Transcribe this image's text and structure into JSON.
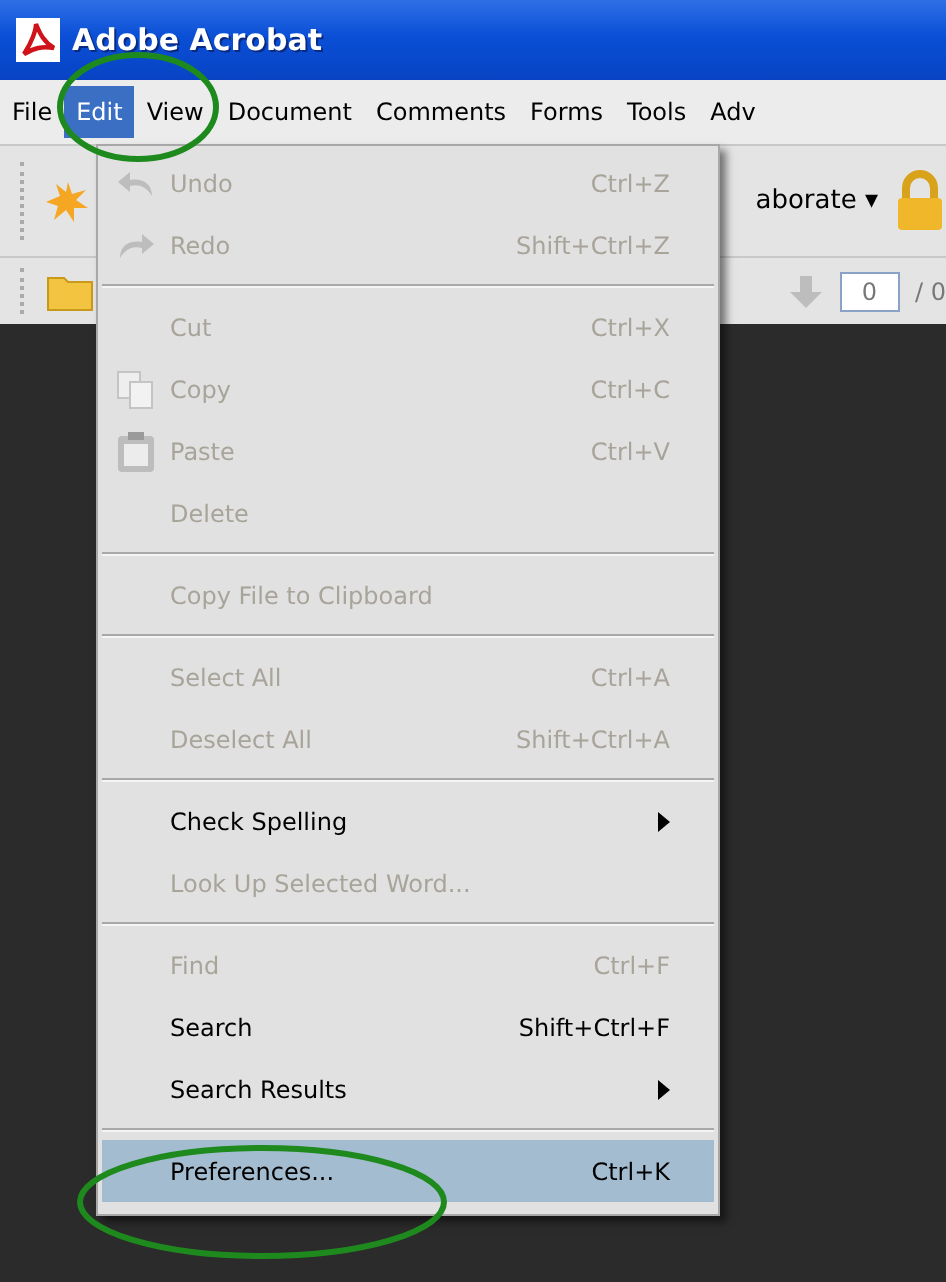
{
  "window": {
    "title": "Adobe Acrobat"
  },
  "menu_bar": [
    {
      "label": "File",
      "selected": false
    },
    {
      "label": "Edit",
      "selected": true
    },
    {
      "label": "View",
      "selected": false
    },
    {
      "label": "Document",
      "selected": false
    },
    {
      "label": "Comments",
      "selected": false
    },
    {
      "label": "Forms",
      "selected": false
    },
    {
      "label": "Tools",
      "selected": false
    },
    {
      "label": "Adv",
      "selected": false
    }
  ],
  "toolbar": {
    "collaborate_label": "aborate",
    "collaborate_arrow": "▾",
    "page_field": "0",
    "page_total": "/ 0"
  },
  "edit_menu": [
    {
      "kind": "command",
      "label": "Undo",
      "shortcut": "Ctrl+Z",
      "disabled": true,
      "selected": false
    },
    {
      "kind": "command",
      "label": "Redo",
      "shortcut": "Shift+Ctrl+Z",
      "disabled": true,
      "selected": false
    },
    {
      "kind": "separator"
    },
    {
      "kind": "command",
      "label": "Cut",
      "shortcut": "Ctrl+X",
      "disabled": true,
      "selected": false
    },
    {
      "kind": "command",
      "label": "Copy",
      "shortcut": "Ctrl+C",
      "disabled": true,
      "selected": false
    },
    {
      "kind": "command",
      "label": "Paste",
      "shortcut": "Ctrl+V",
      "disabled": true,
      "selected": false
    },
    {
      "kind": "command",
      "label": "Delete",
      "disabled": true,
      "selected": false
    },
    {
      "kind": "separator"
    },
    {
      "kind": "command",
      "label": "Copy File to Clipboard",
      "disabled": true,
      "selected": false
    },
    {
      "kind": "separator"
    },
    {
      "kind": "command",
      "label": "Select All",
      "shortcut": "Ctrl+A",
      "disabled": true,
      "selected": false
    },
    {
      "kind": "command",
      "label": "Deselect All",
      "shortcut": "Shift+Ctrl+A",
      "disabled": true,
      "selected": false
    },
    {
      "kind": "separator"
    },
    {
      "kind": "submenu",
      "label": "Check Spelling",
      "disabled": false,
      "selected": false
    },
    {
      "kind": "command",
      "label": "Look Up Selected Word...",
      "disabled": true,
      "selected": false
    },
    {
      "kind": "separator"
    },
    {
      "kind": "command",
      "label": "Find",
      "shortcut": "Ctrl+F",
      "disabled": true,
      "selected": false
    },
    {
      "kind": "command",
      "label": "Search",
      "shortcut": "Shift+Ctrl+F",
      "disabled": false,
      "selected": false
    },
    {
      "kind": "submenu",
      "label": "Search Results",
      "disabled": false,
      "selected": false
    },
    {
      "kind": "separator"
    },
    {
      "kind": "command",
      "label": "Preferences...",
      "shortcut": "Ctrl+K",
      "disabled": false,
      "selected": true
    }
  ]
}
